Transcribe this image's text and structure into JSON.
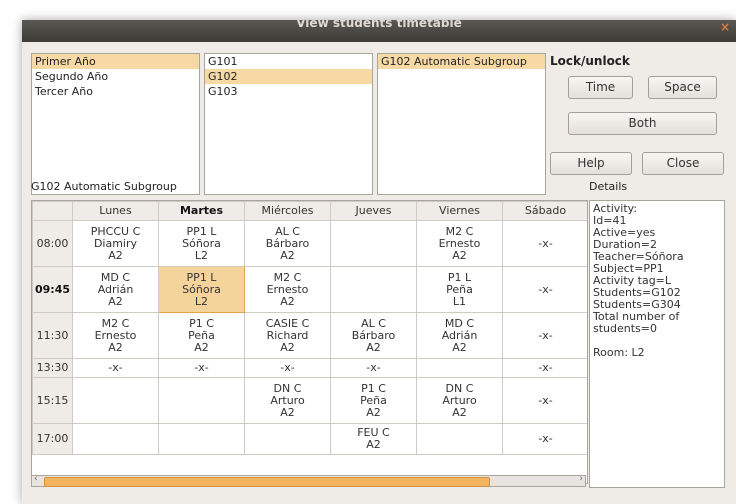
{
  "window": {
    "title": "View students timetable",
    "close_glyph": "×"
  },
  "years": {
    "items": [
      "Primer Año",
      "Segundo Año",
      "Tercer Año"
    ],
    "selected": 0
  },
  "groups": {
    "items": [
      "G101",
      "G102",
      "G103"
    ],
    "selected": 1
  },
  "subgroups": {
    "items": [
      "G102 Automatic Subgroup"
    ],
    "selected": 0
  },
  "lock": {
    "label": "Lock/unlock",
    "time": "Time",
    "space": "Space",
    "both": "Both"
  },
  "buttons": {
    "help": "Help",
    "close": "Close"
  },
  "timetable_label": "G102 Automatic Subgroup",
  "details_label": "Details",
  "timetable": {
    "days": [
      "Lunes",
      "Martes",
      "Miércoles",
      "Jueves",
      "Viernes",
      "Sábado"
    ],
    "bold_day": 1,
    "rows": [
      {
        "time": "08:00",
        "cells": [
          [
            "PHCCU C",
            "Diamiry",
            "A2"
          ],
          [
            "PP1 L",
            "Sóñora",
            "L2"
          ],
          [
            "AL C",
            "Bárbaro",
            "A2"
          ],
          [],
          [
            "M2 C",
            "Ernesto",
            "A2"
          ],
          [
            "-x-"
          ]
        ]
      },
      {
        "time": "09:45",
        "bold": true,
        "cells": [
          [
            "MD C",
            "Adrián",
            "A2"
          ],
          [
            "PP1 L",
            "Sóñora",
            "L2"
          ],
          [
            "M2 C",
            "Ernesto",
            "A2"
          ],
          [],
          [
            "P1 L",
            "Peña",
            "L1"
          ],
          [
            "-x-"
          ]
        ]
      },
      {
        "time": "11:30",
        "cells": [
          [
            "M2 C",
            "Ernesto",
            "A2"
          ],
          [
            "P1 C",
            "Peña",
            "A2"
          ],
          [
            "CASIE C",
            "Richard",
            "A2"
          ],
          [
            "AL C",
            "Bárbaro",
            "A2"
          ],
          [
            "MD C",
            "Adrián",
            "A2"
          ],
          [
            "-x-"
          ]
        ]
      },
      {
        "time": "13:30",
        "cells": [
          [
            "-x-"
          ],
          [
            "-x-"
          ],
          [
            "-x-"
          ],
          [
            "-x-"
          ],
          [],
          [
            "-x-"
          ]
        ]
      },
      {
        "time": "15:15",
        "cells": [
          [],
          [],
          [
            "DN C",
            "Arturo",
            "A2"
          ],
          [
            "P1 C",
            "Peña",
            "A2"
          ],
          [
            "DN C",
            "Arturo",
            "A2"
          ],
          [
            "-x-"
          ]
        ]
      },
      {
        "time": "17:00",
        "cells": [
          [],
          [],
          [],
          [
            "FEU C",
            "A2"
          ],
          [],
          [
            "-x-"
          ]
        ]
      }
    ],
    "highlight": {
      "row": 1,
      "col": 1
    }
  },
  "details": [
    "Activity:",
    "Id=41",
    "Active=yes",
    "Duration=2",
    "Teacher=Sóñora",
    "Subject=PP1",
    "Activity tag=L",
    "Students=G102",
    "Students=G304",
    "Total number of",
    " students=0",
    "",
    "Room: L2"
  ],
  "colors": {
    "selection": "#f6d9a4",
    "highlight": "#f4d49a",
    "scroll_thumb": "#f2b55e"
  }
}
